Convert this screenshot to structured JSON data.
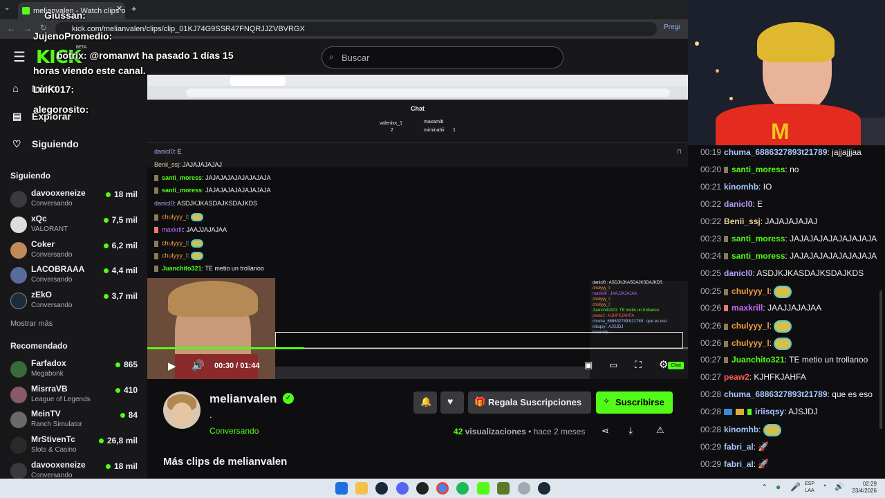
{
  "browser": {
    "tab_title": "melianvalen - Watch clips o",
    "url": "kick.com/melianvalen/clips/clip_01KJ74G9SSR47FNQRJJZVBVRGX",
    "profile_label": "Pregi"
  },
  "header": {
    "logo": "KICK",
    "logo_badge": "BETA",
    "search_placeholder": "Buscar"
  },
  "sidebar": {
    "nav": [
      {
        "label": "Inicio",
        "icon": "home-icon"
      },
      {
        "label": "Explorar",
        "icon": "compass-icon"
      },
      {
        "label": "Siguiendo",
        "icon": "heart-icon"
      }
    ],
    "following_title": "Siguiendo",
    "following": [
      {
        "name": "davooxeneize",
        "sub": "Conversando",
        "viewers": "18 mil"
      },
      {
        "name": "xQc",
        "sub": "VALORANT",
        "viewers": "7,5 mil"
      },
      {
        "name": "Coker",
        "sub": "Conversando",
        "viewers": "6,2 mil"
      },
      {
        "name": "LACOBRAAA",
        "sub": "Conversando",
        "viewers": "4,4 mil"
      },
      {
        "name": "zEkO",
        "sub": "Conversando",
        "viewers": "3,7 mil"
      }
    ],
    "show_more": "Mostrar más",
    "recommended_title": "Recomendado",
    "recommended": [
      {
        "name": "Farfadox",
        "sub": "Megabonk",
        "viewers": "865"
      },
      {
        "name": "MisrraVB",
        "sub": "League of Legends",
        "viewers": "410"
      },
      {
        "name": "MeinTV",
        "sub": "Ranch Simulator",
        "viewers": "84"
      },
      {
        "name": "MrStivenTc",
        "sub": "Slots & Casino",
        "viewers": "26,8 mil"
      },
      {
        "name": "davooxeneize",
        "sub": "Conversando",
        "viewers": "18 mil"
      }
    ]
  },
  "overlay_chat": [
    {
      "text": "Giussan:"
    },
    {
      "text": "JujenoPromedio:"
    },
    {
      "text": "botrix: @romanwt ha pasado 1 días 15"
    },
    {
      "text": "horas viendo este canal."
    },
    {
      "text": "LuiK017:"
    },
    {
      "text": "alegorosito:"
    }
  ],
  "video": {
    "inner_chat_title": "Chat",
    "leaders": [
      {
        "name": "valenixx_1",
        "count": "2"
      },
      {
        "name": "maxamib",
        "count": ""
      },
      {
        "name": "miminahii",
        "count": "1"
      }
    ],
    "chat": [
      {
        "user": "danicl0",
        "color": "#b79cf5",
        "msg": "E"
      },
      {
        "user": "Benii_ssj",
        "color": "#e7d29a",
        "msg": "JAJAJAJAJAJ"
      },
      {
        "user": "santi_moress",
        "color": "#53fc18",
        "msg": "JAJAJAJAJAJAJAJAJA"
      },
      {
        "user": "santi_moress",
        "color": "#53fc18",
        "msg": "JAJAJAJAJAJAJAJAJA"
      },
      {
        "user": "danicl0",
        "color": "#b79cf5",
        "msg": "ASDJKJKASDAJKSDAJKDS"
      },
      {
        "user": "chulyyy_l",
        "color": "#f59b42",
        "msg": ""
      },
      {
        "user": "maxkrill",
        "color": "#c46cff",
        "msg": "JAAJJAJAJAA"
      },
      {
        "user": "chulyyy_l",
        "color": "#f59b42",
        "msg": ""
      },
      {
        "user": "chulyyy_l",
        "color": "#f59b42",
        "msg": ""
      },
      {
        "user": "Juanchito321",
        "color": "#53fc18",
        "msg": "TE metio un trollanoo"
      }
    ],
    "mini_chat": [
      "danicl0 : ASDJKJKASDAJKSDAJKDS",
      "chulyyy_l:",
      "maxkrill : JAAJJAJAJAA",
      "chulyyy_l:",
      "chulyyy_l:",
      "Juanchito321: TE metio un trollanoo",
      "peaw2 : KJHFKJAHFA",
      "chuma_6886327893t21789 : que es eso",
      "iriisqsy : AJSJDJ",
      "kinomhb :"
    ],
    "mini_chat_button": "Chat",
    "time_current": "00:30",
    "time_separator": "/",
    "time_total": "01:44",
    "progress": 0.29
  },
  "clip": {
    "channel": "melianvalen",
    "title": ".",
    "category": "Conversando",
    "gift_label": "Regala Suscripciones",
    "subscribe_label": "Suscribirse",
    "views_count": "42",
    "views_label": "visualizaciones",
    "bullet": "•",
    "date": "hace 2 meses",
    "more_clips": "Más clips de melianvalen"
  },
  "chat": [
    {
      "time": "00:19",
      "user": "chuma_6886327893t21789",
      "color": "#a7c7ff",
      "msg": ": jajjajjjaa",
      "badge": false,
      "emote": false
    },
    {
      "time": "00:20",
      "user": "santi_moress",
      "color": "#53fc18",
      "msg": ": no",
      "badge": true,
      "emote": false
    },
    {
      "time": "00:21",
      "user": "kinomhb",
      "color": "#a7c7ff",
      "msg": ": IO",
      "badge": false,
      "emote": false
    },
    {
      "time": "00:22",
      "user": "danicl0",
      "color": "#b79cf5",
      "msg": ": E",
      "badge": false,
      "emote": false
    },
    {
      "time": "00:22",
      "user": "Benii_ssj",
      "color": "#e7d29a",
      "msg": ": JAJAJAJAJAJ",
      "badge": false,
      "emote": false
    },
    {
      "time": "00:23",
      "user": "santi_moress",
      "color": "#53fc18",
      "msg": ": JAJAJAJAJAJAJAJAJA",
      "badge": true,
      "emote": false
    },
    {
      "time": "00:24",
      "user": "santi_moress",
      "color": "#53fc18",
      "msg": ": JAJAJAJAJAJAJAJAJA",
      "badge": true,
      "emote": false
    },
    {
      "time": "00:25",
      "user": "danicl0",
      "color": "#b79cf5",
      "msg": ": ASDJKJKASDAJKSDAJKDS",
      "badge": false,
      "emote": false
    },
    {
      "time": "00:25",
      "user": "chulyyy_l",
      "color": "#f59b42",
      "msg": ":",
      "badge": true,
      "emote": true
    },
    {
      "time": "00:26",
      "user": "maxkrill",
      "color": "#c46cff",
      "msg": ": JAAJJAJAJAA",
      "badge": true,
      "emote": false
    },
    {
      "time": "00:26",
      "user": "chulyyy_l",
      "color": "#f59b42",
      "msg": ":",
      "badge": true,
      "emote": true
    },
    {
      "time": "00:26",
      "user": "chulyyy_l",
      "color": "#f59b42",
      "msg": ":",
      "badge": true,
      "emote": true
    },
    {
      "time": "00:27",
      "user": "Juanchito321",
      "color": "#53fc18",
      "msg": ": TE metio un trollanoo",
      "badge": true,
      "emote": false
    },
    {
      "time": "00:27",
      "user": "peaw2",
      "color": "#ff5a5a",
      "msg": ": KJHFKJAHFA",
      "badge": false,
      "emote": false
    },
    {
      "time": "00:28",
      "user": "chuma_6886327893t21789",
      "color": "#a7c7ff",
      "msg": ": que es eso",
      "badge": false,
      "emote": false
    },
    {
      "time": "00:28",
      "user": "iriisqsy",
      "color": "#a7c7ff",
      "msg": ": AJSJDJ",
      "badge": true,
      "emote": false
    },
    {
      "time": "00:28",
      "user": "kinomhb",
      "color": "#a7c7ff",
      "msg": ":",
      "badge": false,
      "emote": true
    },
    {
      "time": "00:29",
      "user": "fabri_al",
      "color": "#a7c7ff",
      "msg": ":",
      "badge": false,
      "emote": false
    },
    {
      "time": "00:29",
      "user": "fabri_al",
      "color": "#a7c7ff",
      "msg": ":",
      "badge": false,
      "emote": false
    }
  ],
  "taskbar": {
    "lang_top": "ESP",
    "lang_bottom": "LAA",
    "time": "02:29",
    "date": "23/4/2026"
  },
  "colors": {
    "accent": "#53fc18",
    "bg": "#0e0e10",
    "panel": "#18181b"
  }
}
